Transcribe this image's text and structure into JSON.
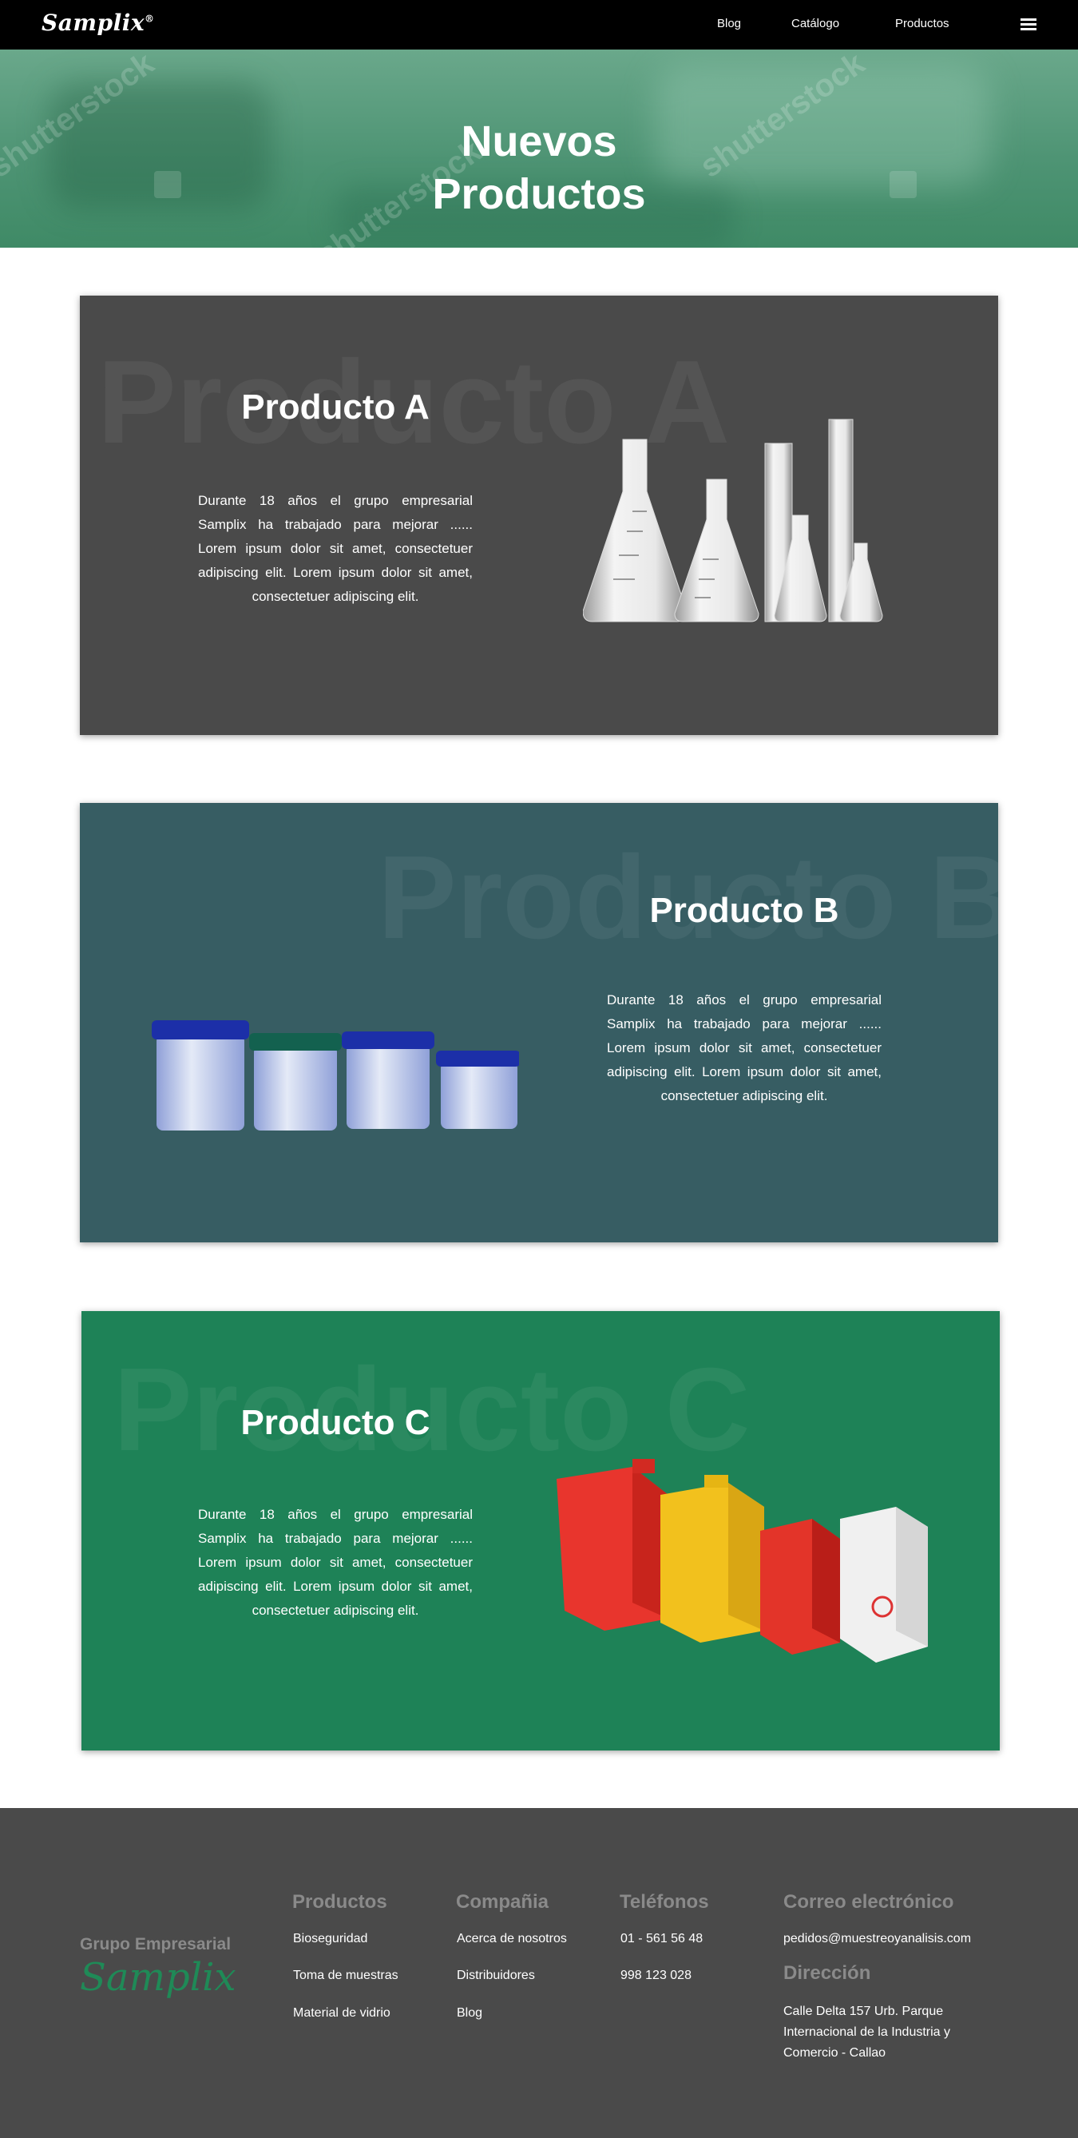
{
  "nav": {
    "logo": "Samplix",
    "logo_mark": "®",
    "links": [
      "Blog",
      "Catálogo",
      "Productos"
    ],
    "menu_icon": "hamburger-menu-icon"
  },
  "hero": {
    "title_line1": "Nuevos",
    "title_line2": "Productos",
    "watermark": "shutterstock"
  },
  "products": [
    {
      "watermark": "Producto A",
      "title": "Producto A",
      "description": "Durante 18 años el grupo empresarial Samplix ha trabajado para mejorar ...... Lorem ipsum dolor sit amet, consectetuer adipiscing elit.  Lorem ipsum dolor sit amet, consectetuer adipiscing elit.",
      "background": "#4a4a4a",
      "image": "laboratory-glassware-image"
    },
    {
      "watermark": "Producto B",
      "title": "Producto B",
      "description": "Durante 18 años el grupo empresarial Samplix ha trabajado para mejorar ...... Lorem ipsum dolor sit amet, consectetuer adipiscing elit.  Lorem ipsum dolor sit amet, consectetuer adipiscing elit.",
      "background": "#375d63",
      "image": "sample-containers-image"
    },
    {
      "watermark": "Producto C",
      "title": "Producto C",
      "description": "Durante 18 años el grupo empresarial Samplix ha trabajado para mejorar ...... Lorem ipsum dolor sit amet, consectetuer adipiscing elit.  Lorem ipsum dolor sit amet, consectetuer adipiscing elit.",
      "background": "#1e8257",
      "image": "biohazard-boxes-image"
    }
  ],
  "footer": {
    "brand_line1": "Grupo Empresarial",
    "brand_line2": "Samplix",
    "productos": {
      "heading": "Productos",
      "items": [
        "Bioseguridad",
        "Toma de muestras",
        "Material de vidrio"
      ]
    },
    "compania": {
      "heading": "Compañia",
      "items": [
        "Acerca de nosotros",
        "Distribuidores",
        "Blog"
      ]
    },
    "telefonos": {
      "heading": "Teléfonos",
      "items": [
        "01 - 561 56 48",
        "998 123 028"
      ]
    },
    "correo": {
      "heading": "Correo electrónico",
      "email": "pedidos@muestreoyanalisis.com"
    },
    "direccion": {
      "heading": "Dirección",
      "address": "Calle Delta 157 Urb. Parque Internacional de la Industria y Comercio - Callao"
    }
  },
  "colors": {
    "nav_bg": "#000000",
    "hero_green": "#4e9474",
    "footer_bg": "#4a4a4a",
    "footer_heading": "#8a8a8a",
    "brand_green": "#1f8a57"
  }
}
